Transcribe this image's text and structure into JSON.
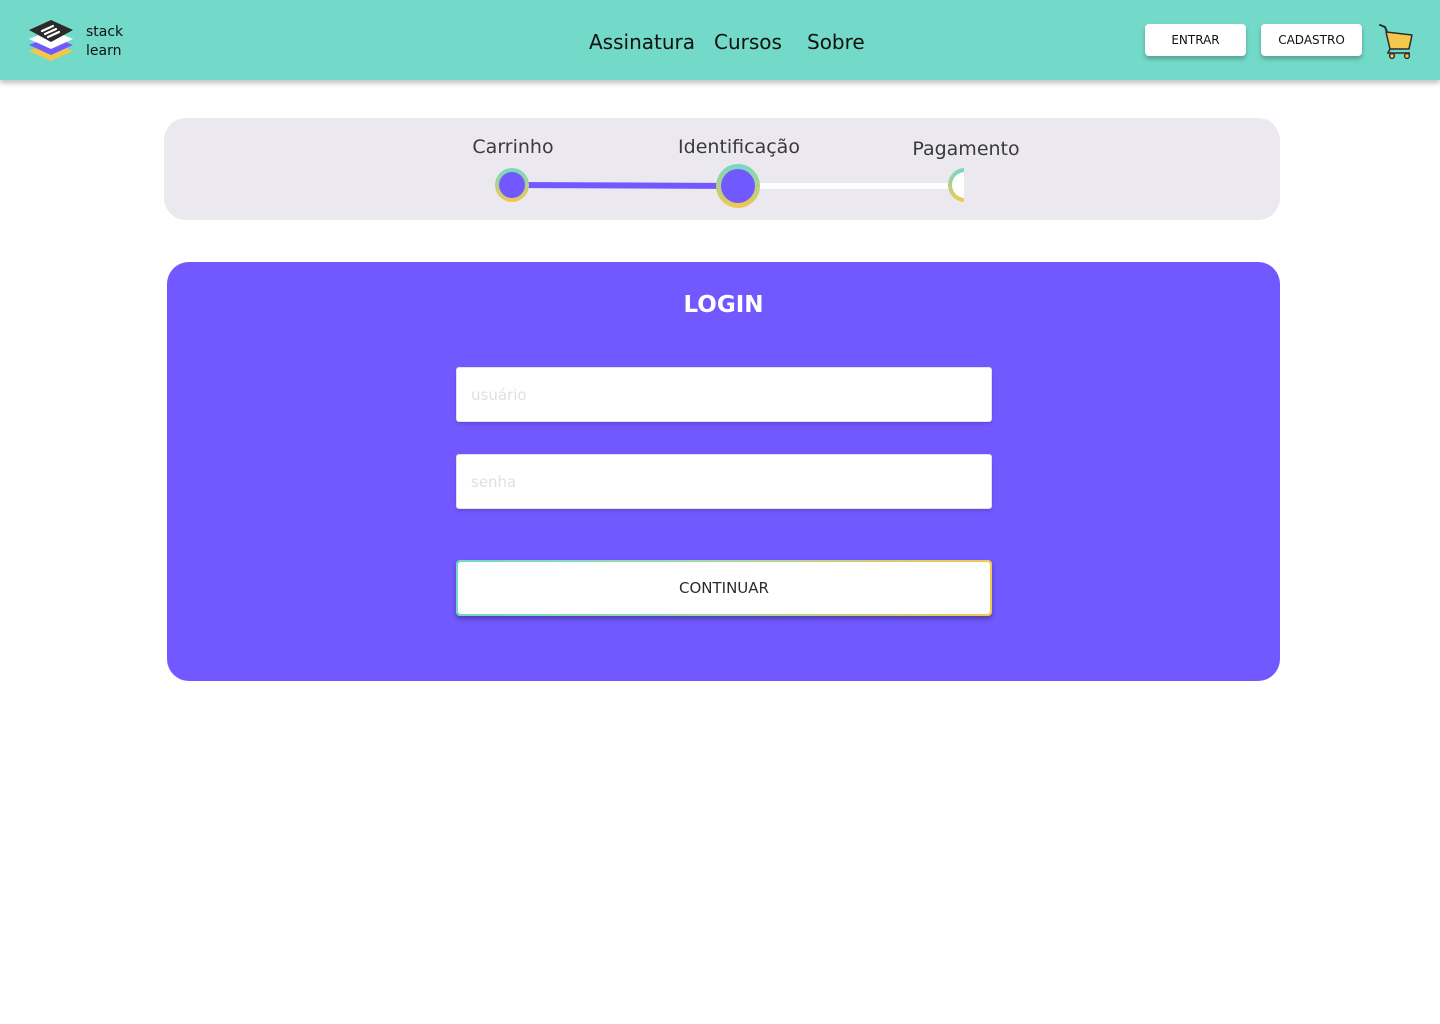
{
  "brand": {
    "line1": "stack",
    "line2": "learn",
    "colors": {
      "header": "#73d9c8",
      "primary": "#7159ff",
      "accent": "#f2c84b",
      "dark": "#2b2b2b"
    }
  },
  "nav": {
    "items": [
      {
        "label": "Assinatura"
      },
      {
        "label": "Cursos"
      },
      {
        "label": "Sobre"
      }
    ]
  },
  "header_buttons": {
    "login_label": "ENTRAR",
    "signup_label": "CADASTRO"
  },
  "cart": {
    "icon": "shopping-cart-icon"
  },
  "steps": {
    "current": 2,
    "items": [
      {
        "label": "Carrinho",
        "state": "done"
      },
      {
        "label": "Identificação",
        "state": "current"
      },
      {
        "label": "Pagamento",
        "state": "pending"
      }
    ]
  },
  "login": {
    "title": "LOGIN",
    "username": {
      "placeholder": "usuário",
      "value": ""
    },
    "password": {
      "placeholder": "senha",
      "value": ""
    },
    "continue_label": "CONTINUAR"
  }
}
